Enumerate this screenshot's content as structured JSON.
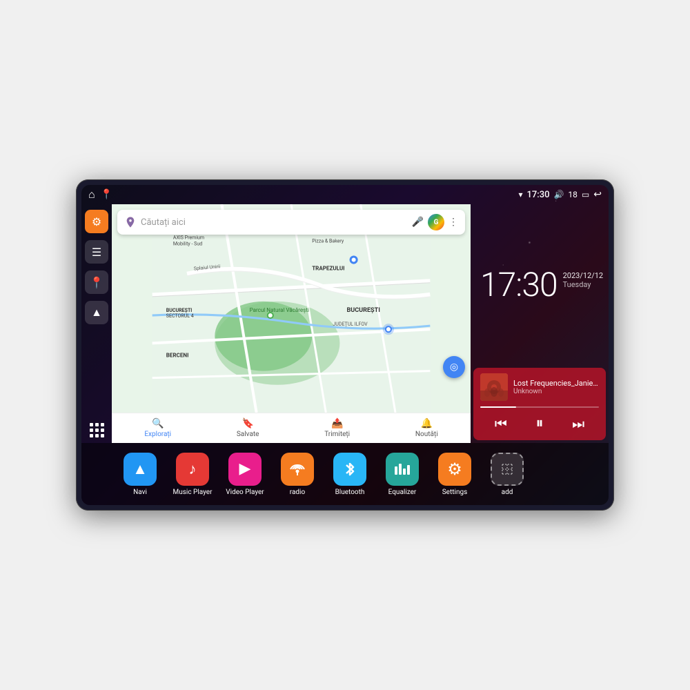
{
  "device": {
    "status_bar": {
      "wifi_icon": "▾",
      "time": "17:30",
      "volume_icon": "🔊",
      "battery_num": "18",
      "battery_icon": "▭",
      "back_icon": "↩"
    },
    "clock": {
      "time": "17:30",
      "date_line1": "2023/12/12",
      "date_line2": "Tuesday"
    },
    "music": {
      "title": "Lost Frequencies_Janie...",
      "artist": "Unknown"
    },
    "map": {
      "search_placeholder": "Căutați aici",
      "locations": [
        "AXIS Premium Mobility - Sud",
        "Pizza & Bakery",
        "Parcul Natural Văcărești",
        "BUCUREȘTI",
        "BUCUREȘTI SECTORUL 4",
        "JUDEȚUL ILFOV",
        "BERCENI",
        "TRAPEZULUI"
      ],
      "nav_items": [
        "Explorați",
        "Salvate",
        "Trimiteți",
        "Noutăți"
      ]
    },
    "apps": [
      {
        "id": "navi",
        "label": "Navi",
        "icon_color": "blue",
        "icon": "▲"
      },
      {
        "id": "music-player",
        "label": "Music Player",
        "icon_color": "red",
        "icon": "♪"
      },
      {
        "id": "video-player",
        "label": "Video Player",
        "icon_color": "pink",
        "icon": "▶"
      },
      {
        "id": "radio",
        "label": "radio",
        "icon_color": "orange",
        "icon": "📻"
      },
      {
        "id": "bluetooth",
        "label": "Bluetooth",
        "icon_color": "light-blue",
        "icon": "⚡"
      },
      {
        "id": "equalizer",
        "label": "Equalizer",
        "icon_color": "teal",
        "icon": "≡"
      },
      {
        "id": "settings",
        "label": "Settings",
        "icon_color": "amber",
        "icon": "⚙"
      },
      {
        "id": "add",
        "label": "add",
        "icon_color": "gray",
        "icon": "+"
      }
    ]
  }
}
